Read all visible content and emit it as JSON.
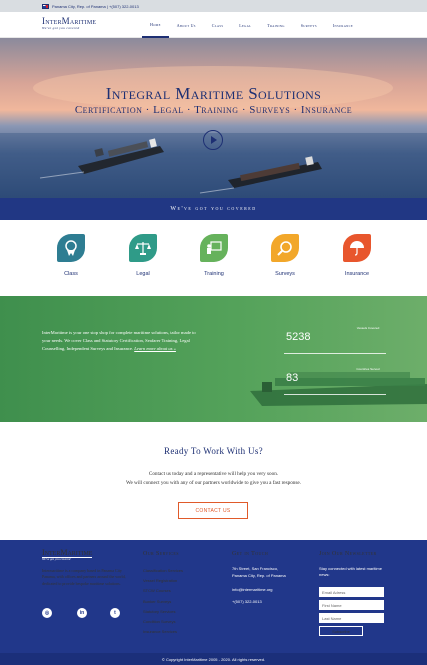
{
  "topbar": {
    "location": "Panama City, Rep. of Panama",
    "phone": "+(507) 322-0013"
  },
  "brand": {
    "logo": "InterMaritime",
    "tagline": "We've got you covered"
  },
  "nav": {
    "items": [
      "Home",
      "About Us",
      "Class",
      "Legal",
      "Training",
      "Surveys",
      "Insurance"
    ]
  },
  "hero": {
    "title": "Integral Maritime Solutions",
    "subtitle": "Certification · Legal · Training · Surveys · Insurance"
  },
  "band": {
    "text": "We've got you covered"
  },
  "services": [
    {
      "label": "Class",
      "icon": "certificate-icon",
      "color": "#2e7d92"
    },
    {
      "label": "Legal",
      "icon": "scales-icon",
      "color": "#2f9b88"
    },
    {
      "label": "Training",
      "icon": "presentation-icon",
      "color": "#66b25c"
    },
    {
      "label": "Surveys",
      "icon": "magnifier-icon",
      "color": "#f2a72a"
    },
    {
      "label": "Insurance",
      "icon": "umbrella-icon",
      "color": "#e8562d"
    }
  ],
  "about": {
    "text": "InterMaritime is your one stop shop for complete maritime solutions, tailor made to your needs. We cover Class and Statutory Certification, Seafarer Training, Legal Counselling, Independent Surveys and Insurance.",
    "link": "Learn more about us »"
  },
  "stats": [
    {
      "value": "5238",
      "label": "Vessels Covered"
    },
    {
      "value": "83",
      "label": "Countries Served"
    }
  ],
  "cta": {
    "title": "Ready To Work With Us?",
    "line1": "Contact us today and a representative will help you very soon.",
    "line2": "We will connect you with any of our partners worldwide to give you a fast response.",
    "button": "CONTACT US"
  },
  "footer": {
    "logo": "InterMaritime",
    "tagline": "We've got you covered",
    "about": "Intermaritime is a company based in Panama City Panama, with offices and partners around the world, dedicated to provide bespoke maritime solutions.",
    "social": [
      "instagram-icon",
      "linkedin-icon",
      "twitter-icon"
    ],
    "services_title": "Our Services",
    "services": [
      "Classification Services",
      "Vessel Registration",
      "STCW Courses",
      "Bunker Surveys",
      "Statutory Services",
      "Condition Surveys",
      "Insurance Services"
    ],
    "contact_title": "Get in Touch",
    "address": [
      "7th Street, San Francisco,",
      "Panama City, Rep. of Panama"
    ],
    "email": "info@intermaritime.org",
    "phone": "+(507) 322-0013",
    "newsletter_title": "Join Our Newsletter",
    "newsletter_text": "Stay connected with latest maritime news:",
    "email_placeholder": "Email Adress",
    "first_placeholder": "First Name",
    "last_placeholder": "Last Name",
    "subscribe": "Subscribe"
  },
  "copyright": "© Copyright InterMaritime 2005 - 2020. All rights reserved."
}
